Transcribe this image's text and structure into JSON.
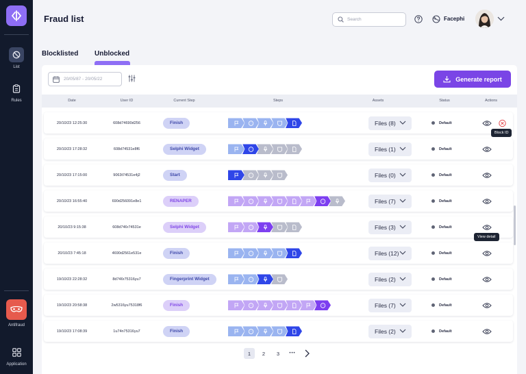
{
  "app": {
    "page_title": "Fraud list",
    "user_name": "Facephi"
  },
  "search": {
    "placeholder": "Search"
  },
  "sidebar": {
    "items": [
      {
        "label": "List",
        "icon": "ban-icon",
        "active": true
      },
      {
        "label": "Rules",
        "icon": "clipboard-icon",
        "active": false
      }
    ],
    "bottom": [
      {
        "label": "Antifraud",
        "icon": "mask-icon"
      },
      {
        "label": "Application",
        "icon": "grid-icon"
      }
    ]
  },
  "tabs": [
    {
      "label": "Blocklisted",
      "active": false
    },
    {
      "label": "Unblocked",
      "active": true
    }
  ],
  "toolbar": {
    "date_placeholder": "20/05/87 - 20/05/22",
    "generate_label": "Generate report"
  },
  "table": {
    "columns": [
      "Date",
      "User ID",
      "Current Step",
      "Steps",
      "Assets",
      "Status",
      "Actions"
    ],
    "rows": [
      {
        "date": "20/10/23 12:25:30",
        "user_id": "608d74690d256",
        "step": "Finish",
        "assets": "Files (8)",
        "status": "Default"
      },
      {
        "date": "20/10/23 17:28:32",
        "user_id": "608d74531e8f6",
        "step": "Selphi Widget",
        "assets": "Files (1)",
        "status": "Default"
      },
      {
        "date": "20/10/23 17:15:00",
        "user_id": "9063t74531e4j2",
        "step": "Start",
        "assets": "Files (0)",
        "status": "Default"
      },
      {
        "date": "20/10/23 16:55:40",
        "user_id": "690d256091e8e1",
        "step": "RENAPER",
        "assets": "Files (7)",
        "status": "Default"
      },
      {
        "date": "20/10/23 9:15:38",
        "user_id": "608d746r74531e",
        "step": "Selphi Widget",
        "assets": "Files (3)",
        "status": "Default"
      },
      {
        "date": "20/10/23 7:45:18",
        "user_id": "4690d2561e531e",
        "step": "Finish",
        "assets": "Files (12)",
        "status": "Default"
      },
      {
        "date": "19/10/23 22:28:32",
        "user_id": "8d746r75316yu7",
        "step": "Fingerprint Widget",
        "assets": "Files (2)",
        "status": "Default"
      },
      {
        "date": "19/10/23 20:58:38",
        "user_id": "2w5316yu75318f6",
        "step": "Finish",
        "assets": "Files (7)",
        "status": "Default"
      },
      {
        "date": "19/10/23 17:08:39",
        "user_id": "1u74n75316yu7",
        "step": "Finish",
        "assets": "Files (2)",
        "status": "Default"
      }
    ]
  },
  "tooltips": {
    "block": "Block ID",
    "view": "View detail"
  },
  "pagination": {
    "pages": [
      "1",
      "2",
      "3"
    ],
    "ellipsis": "•••",
    "current": "1"
  },
  "colors": {
    "accent": "#7a45e6",
    "sidebar": "#121a2c",
    "step_blue": "#2f46e8",
    "step_purple": "#7d3ff0"
  }
}
